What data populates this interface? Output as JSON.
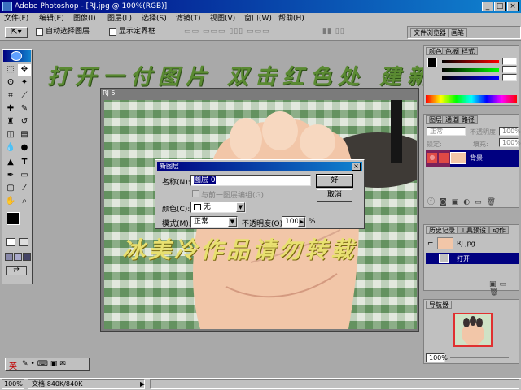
{
  "titlebar": {
    "title": "Adobe Photoshop - [RJ.jpg @ 100%(RGB)]"
  },
  "menus": [
    "文件(F)",
    "编辑(E)",
    "图像(I)",
    "图层(L)",
    "选择(S)",
    "滤镜(T)",
    "视图(V)",
    "窗口(W)",
    "帮助(H)"
  ],
  "options": {
    "auto_select_layer": "自动选择图层",
    "show_bounds": "显示定界框",
    "file_browser_tabs": [
      "文件浏览器",
      "画笔"
    ]
  },
  "overlay": {
    "instruction": "打开一付图片 双击红色处 建新图层",
    "watermark": "冰美冷作品请勿转载"
  },
  "document": {
    "corner_label": "RJ 5"
  },
  "dialog": {
    "title": "新图层",
    "name_label": "名称(N):",
    "name_value": "图层 0",
    "group_label": "与前一图层编组(G)",
    "color_label": "颜色(C):",
    "color_value": "无",
    "mode_label": "模式(M):",
    "mode_value": "正常",
    "opacity_label": "不透明度(O):",
    "opacity_value": "100",
    "opacity_unit": "%",
    "ok": "好",
    "cancel": "取消"
  },
  "color_panel": {
    "tabs": [
      "颜色",
      "色板",
      "样式"
    ]
  },
  "layers_panel": {
    "tabs": [
      "图层",
      "通道",
      "路径"
    ],
    "mode": "正常",
    "opacity_label": "不透明度:",
    "opacity": "100%",
    "lock_label": "锁定:",
    "fill_label": "填充:",
    "fill": "100%",
    "layer_name": "背景",
    "highlight_color": "#e03030"
  },
  "history_panel": {
    "tabs": [
      "历史记录",
      "工具预设",
      "动作"
    ],
    "snapshot": "RJ.jpg",
    "step": "打开"
  },
  "navigator_panel": {
    "tabs": [
      "导航器"
    ],
    "zoom": "100%"
  },
  "statusbar": {
    "zoom": "100%",
    "doc_size": "文档:840K/840K"
  },
  "ime_bar": {
    "mode": "英"
  }
}
